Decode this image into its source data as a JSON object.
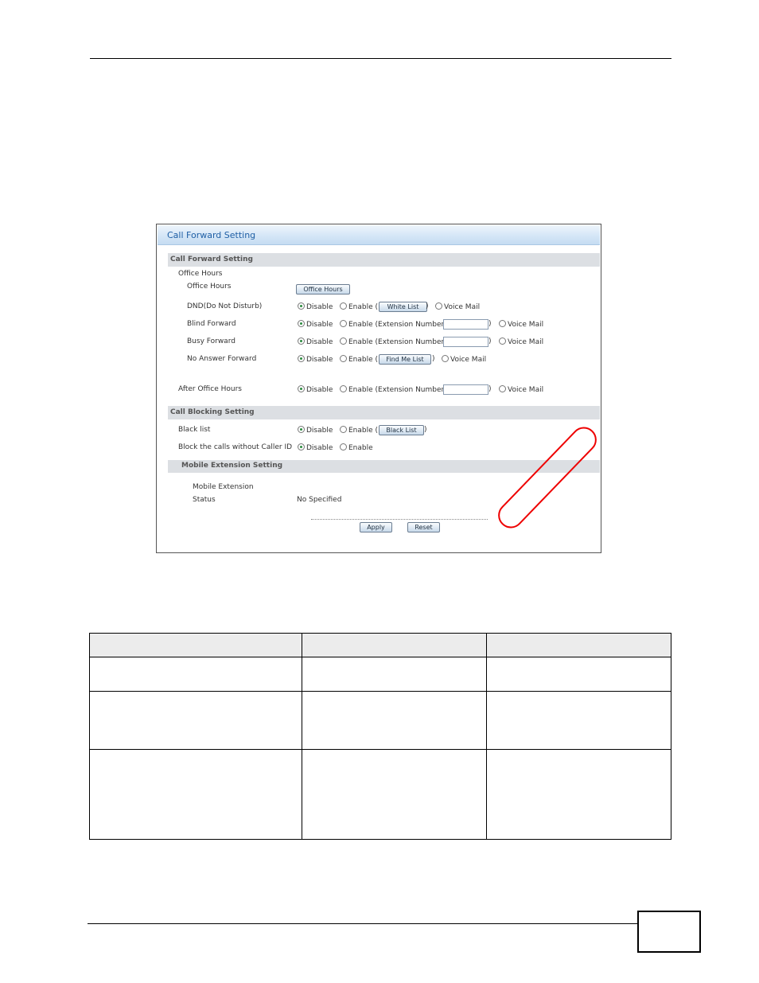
{
  "window": {
    "title": "Call Forward Setting"
  },
  "call_forward": {
    "section_title": "Call Forward Setting",
    "office_hours_header": "Office Hours",
    "office_hours_label": "Office Hours",
    "office_hours_button": "Office Hours",
    "dnd": {
      "label": "DND(Do Not Disturb)",
      "disable": "Disable",
      "enable": "Enable (",
      "button": "White List",
      "close": ")",
      "voice_mail": "Voice Mail"
    },
    "blind": {
      "label": "Blind Forward",
      "disable": "Disable",
      "enable": "Enable (Extension Number:",
      "value": "",
      "close": ")",
      "voice_mail": "Voice Mail"
    },
    "busy": {
      "label": "Busy Forward",
      "disable": "Disable",
      "enable": "Enable (Extension Number:",
      "value": "",
      "close": ")",
      "voice_mail": "Voice Mail"
    },
    "no_answer": {
      "label": "No Answer Forward",
      "disable": "Disable",
      "enable": "Enable (",
      "button": "Find Me List",
      "close": ")",
      "voice_mail": "Voice Mail"
    },
    "after_hours": {
      "label": "After Office Hours",
      "disable": "Disable",
      "enable": "Enable (Extension Number:",
      "value": "",
      "close": ")",
      "voice_mail": "Voice Mail"
    }
  },
  "call_blocking": {
    "section_title": "Call Blocking Setting",
    "black_list": {
      "label": "Black list",
      "disable": "Disable",
      "enable": "Enable (",
      "button": "Black List",
      "close": ")"
    },
    "no_caller_id": {
      "label": "Block the calls without Caller ID",
      "disable": "Disable",
      "enable": "Enable"
    }
  },
  "mobile": {
    "section_title": "Mobile Extension Setting",
    "label": "Mobile Extension",
    "status_label": "Status",
    "status_value": "No Specified"
  },
  "actions": {
    "apply": "Apply",
    "reset": "Reset"
  },
  "colors": {
    "title_text": "#1f5fa5",
    "section_bg": "#dcdfe3",
    "highlight": "#ee0000",
    "selected_radio": "#2b8a3e"
  }
}
